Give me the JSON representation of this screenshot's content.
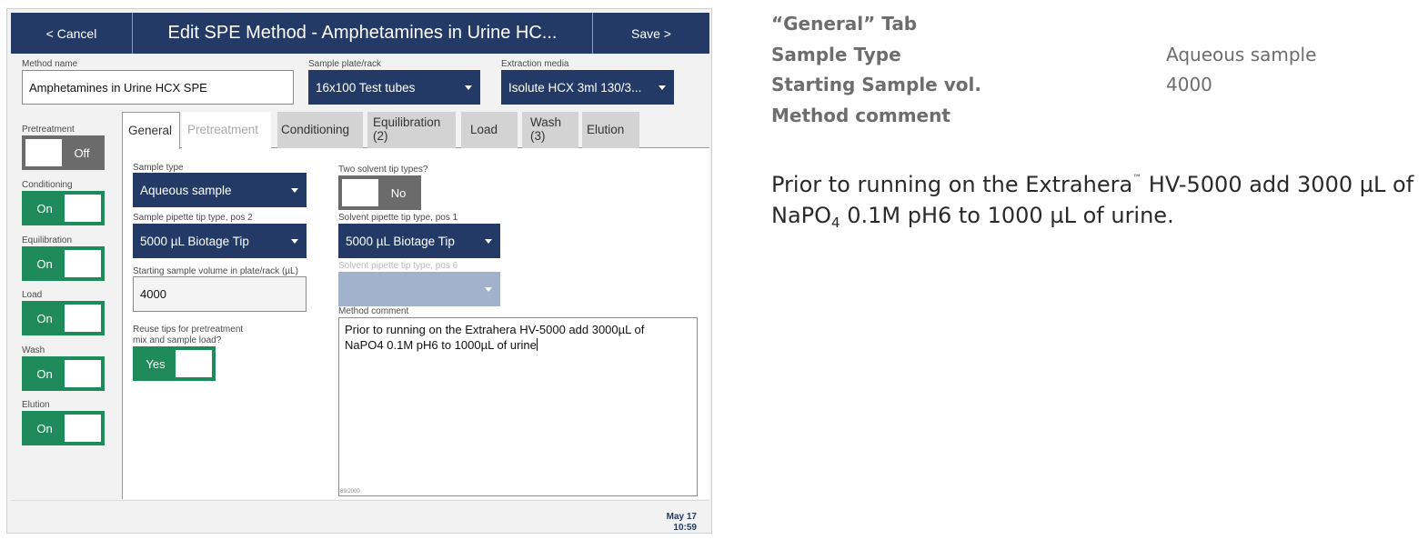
{
  "app": {
    "header": {
      "cancel_label": "< Cancel",
      "title": "Edit SPE Method - Amphetamines in Urine HC...",
      "save_label": "Save >"
    },
    "method_name": {
      "label": "Method name",
      "value": "Amphetamines in Urine HCX SPE"
    },
    "sample_plate": {
      "label": "Sample plate/rack",
      "value": "16x100 Test tubes"
    },
    "extraction_media": {
      "label": "Extraction media",
      "value": "Isolute HCX 3ml 130/3..."
    },
    "side_toggles": [
      {
        "label": "Pretreatment",
        "state": "Off"
      },
      {
        "label": "Conditioning",
        "state": "On"
      },
      {
        "label": "Equilibration",
        "state": "On"
      },
      {
        "label": "Load",
        "state": "On"
      },
      {
        "label": "Wash",
        "state": "On"
      },
      {
        "label": "Elution",
        "state": "On"
      }
    ],
    "tabs": [
      {
        "label": "General"
      },
      {
        "label": "Pretreatment"
      },
      {
        "label": "Conditioning"
      },
      {
        "label": "Equilibration",
        "sub": "(2)"
      },
      {
        "label": "Load"
      },
      {
        "label": "Wash",
        "sub": "(3)"
      },
      {
        "label": "Elution"
      }
    ],
    "general": {
      "sample_type": {
        "label": "Sample type",
        "value": "Aqueous sample"
      },
      "sample_tip": {
        "label": "Sample pipette tip type, pos 2",
        "value": "5000 µL Biotage Tip"
      },
      "starting_volume": {
        "label": "Starting sample volume in plate/rack (µL)",
        "value": "4000"
      },
      "reuse_tips": {
        "label_line1": "Reuse tips for pretreatment",
        "label_line2": "mix and sample load?",
        "state": "Yes"
      },
      "two_solvent": {
        "label": "Two solvent tip types?",
        "state": "No"
      },
      "solvent_tip_1": {
        "label": "Solvent pipette tip type, pos 1",
        "value": "5000 µL Biotage Tip"
      },
      "solvent_tip_6": {
        "label": "Solvent pipette tip type, pos 6",
        "value": ""
      },
      "method_comment": {
        "label": "Method comment",
        "line1": "Prior to running on the Extrahera HV-5000 add 3000µL of",
        "line2": "NaPO4 0.1M pH6 to 1000µL of urine",
        "counter": "89/2000"
      }
    },
    "footer": {
      "date": "May 17",
      "time": "10:59"
    },
    "colors": {
      "navy": "#243a66",
      "green": "#1f8a5a",
      "gray_toggle": "#6b6b6b"
    }
  },
  "notes": {
    "heading": "“General” Tab",
    "rows": [
      {
        "key": "Sample Type",
        "value": "Aqueous sample"
      },
      {
        "key": "Starting Sample vol.",
        "value": "4000"
      },
      {
        "key": "Method comment",
        "value": ""
      }
    ],
    "paragraph": {
      "part1": "Prior to running on the Extrahera",
      "tm": "™",
      "part2": " HV-5000 add 3000 µL of NaPO",
      "sub4": "4",
      "part3": " 0.1M pH6 to 1000 µL of urine."
    }
  }
}
